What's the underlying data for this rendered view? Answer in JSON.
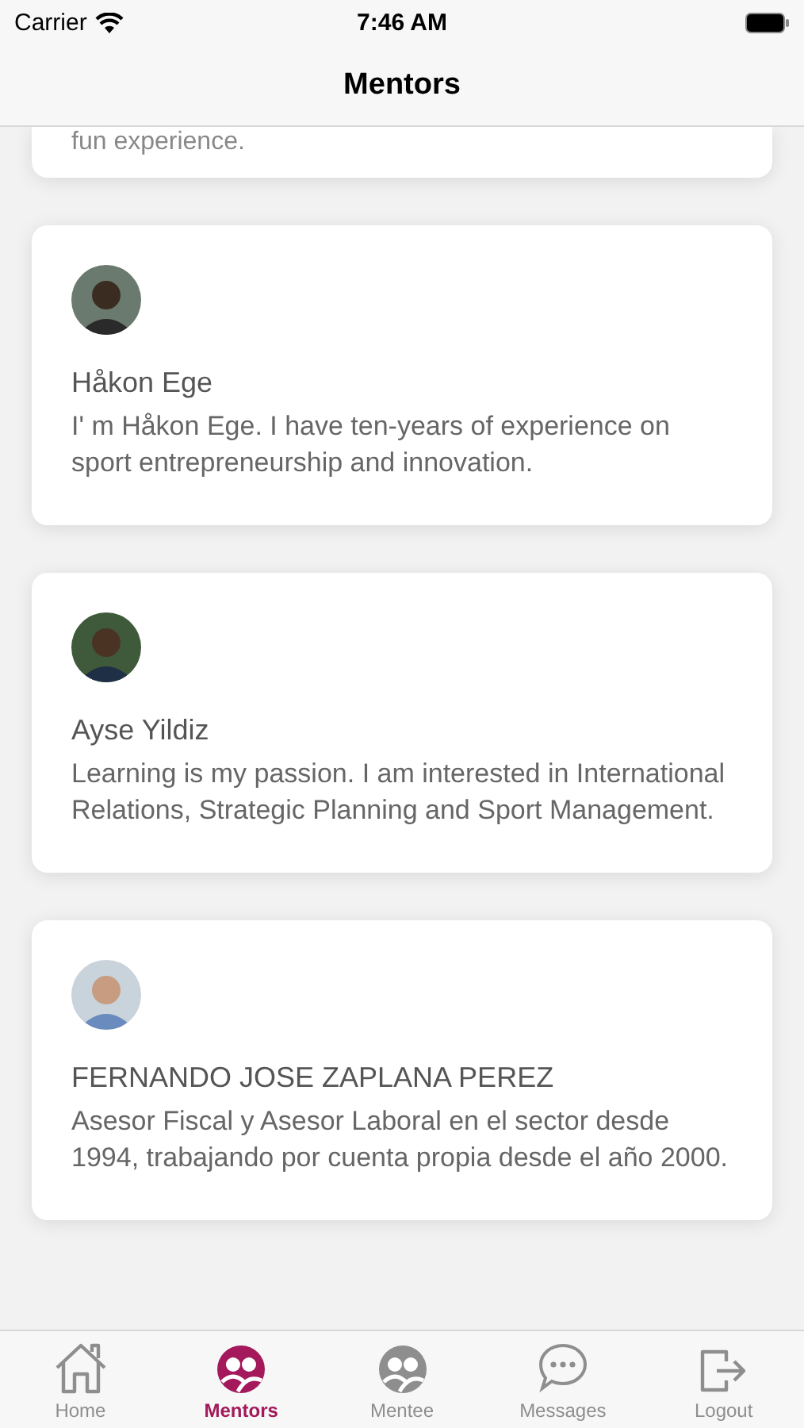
{
  "status_bar": {
    "carrier": "Carrier",
    "time": "7:46 AM"
  },
  "nav": {
    "title": "Mentors"
  },
  "partial_card": {
    "text": "fun experience."
  },
  "mentors": [
    {
      "name": "Håkon Ege",
      "bio": "I' m Håkon Ege. I have ten-years of experience on sport entrepreneurship and innovation."
    },
    {
      "name": "Ayse Yildiz",
      "bio": "Learning is my passion. I am interested in International Relations, Strategic Planning and Sport Management."
    },
    {
      "name": "FERNANDO JOSE ZAPLANA PEREZ",
      "bio": "Asesor Fiscal y Asesor Laboral en el sector desde 1994, trabajando por cuenta propia desde el año 2000."
    }
  ],
  "tabs": [
    {
      "label": "Home",
      "kind": "home",
      "selected": false
    },
    {
      "label": "Mentors",
      "kind": "people",
      "selected": true
    },
    {
      "label": "Mentee",
      "kind": "people",
      "selected": false
    },
    {
      "label": "Messages",
      "kind": "chat",
      "selected": false
    },
    {
      "label": "Logout",
      "kind": "logout",
      "selected": false
    }
  ]
}
